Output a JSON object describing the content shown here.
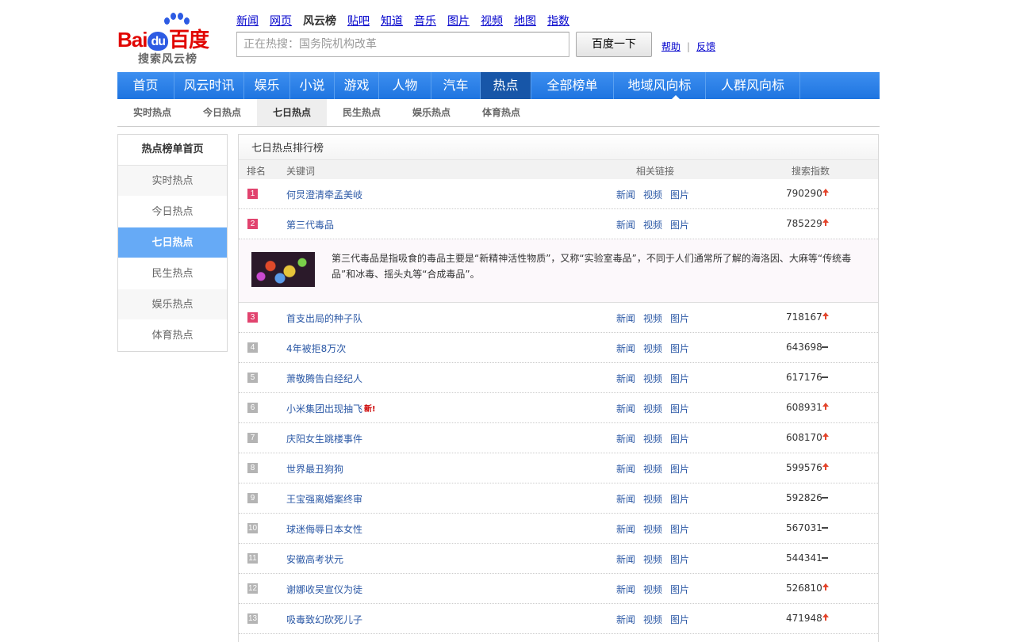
{
  "logo": {
    "brand_latin": "Bai",
    "brand_du": "du",
    "brand_cn": "百度",
    "subtitle": "搜索风云榜"
  },
  "toplinks": [
    "新闻",
    "网页",
    "风云榜",
    "贴吧",
    "知道",
    "音乐",
    "图片",
    "视频",
    "地图",
    "指数"
  ],
  "toplinks_current": "风云榜",
  "search": {
    "placeholder": "正在热搜：国务院机构改革",
    "button": "百度一下"
  },
  "help": {
    "help": "帮助",
    "sep": "|",
    "feedback": "反馈"
  },
  "mainnav": [
    "首页",
    "风云时讯",
    "娱乐",
    "小说",
    "游戏",
    "人物",
    "汽车",
    "热点",
    "全部榜单",
    "地域风向标",
    "人群风向标"
  ],
  "mainnav_active": "热点",
  "subnav": [
    "实时热点",
    "今日热点",
    "七日热点",
    "民生热点",
    "娱乐热点",
    "体育热点"
  ],
  "subnav_active": "七日热点",
  "sidebar": {
    "header": "热点榜单首页",
    "items": [
      "实时热点",
      "今日热点",
      "七日热点",
      "民生热点",
      "娱乐热点",
      "体育热点"
    ],
    "active": "七日热点"
  },
  "panel": {
    "title": "七日热点排行榜",
    "columns": {
      "rank": "排名",
      "keyword": "关键词",
      "links": "相关链接",
      "index": "搜索指数"
    },
    "link_labels": [
      "新闻",
      "视频",
      "图片"
    ],
    "rows": [
      {
        "rank": "1",
        "keyword": "何炅澄清牵孟美岐",
        "index": "790290",
        "trend": "up",
        "is_new": false
      },
      {
        "rank": "2",
        "keyword": "第三代毒品",
        "index": "785229",
        "trend": "up",
        "is_new": false
      },
      {
        "rank": "3",
        "keyword": "首支出局的种子队",
        "index": "718167",
        "trend": "up",
        "is_new": false
      },
      {
        "rank": "4",
        "keyword": "4年被拒8万次",
        "index": "643698",
        "trend": "flat",
        "is_new": false
      },
      {
        "rank": "5",
        "keyword": "萧敬腾告白经纪人",
        "index": "617176",
        "trend": "flat",
        "is_new": false
      },
      {
        "rank": "6",
        "keyword": "小米集团出现抽飞",
        "index": "608931",
        "trend": "up",
        "is_new": true
      },
      {
        "rank": "7",
        "keyword": "庆阳女生跳楼事件",
        "index": "608170",
        "trend": "up",
        "is_new": false
      },
      {
        "rank": "8",
        "keyword": "世界最丑狗狗",
        "index": "599576",
        "trend": "up",
        "is_new": false
      },
      {
        "rank": "9",
        "keyword": "王宝强离婚案终审",
        "index": "592826",
        "trend": "flat",
        "is_new": false
      },
      {
        "rank": "10",
        "keyword": "球迷侮辱日本女性",
        "index": "567031",
        "trend": "flat",
        "is_new": false
      },
      {
        "rank": "11",
        "keyword": "安徽高考状元",
        "index": "544341",
        "trend": "flat",
        "is_new": false
      },
      {
        "rank": "12",
        "keyword": "谢娜收吴宣仪为徒",
        "index": "526810",
        "trend": "up",
        "is_new": false
      },
      {
        "rank": "13",
        "keyword": "吸毒致幻砍死儿子",
        "index": "471948",
        "trend": "up",
        "is_new": false
      }
    ],
    "new_label": "新!",
    "detail_after_rank": "2",
    "detail_text": "第三代毒品是指吸食的毒品主要是“新精神活性物质”，又称“实验室毒品”，不同于人们通常所了解的海洛因、大麻等“传统毒品”和冰毒、摇头丸等“合成毒品”。"
  },
  "colors": {
    "nav_blue": "#1e74e0",
    "nav_active": "#1756a8",
    "sidebar_active": "#66aaf6",
    "rank_top": "#e1436e",
    "rank_other": "#b4b4b4",
    "link": "#2c59a6",
    "trend_up": "#e3452c"
  }
}
